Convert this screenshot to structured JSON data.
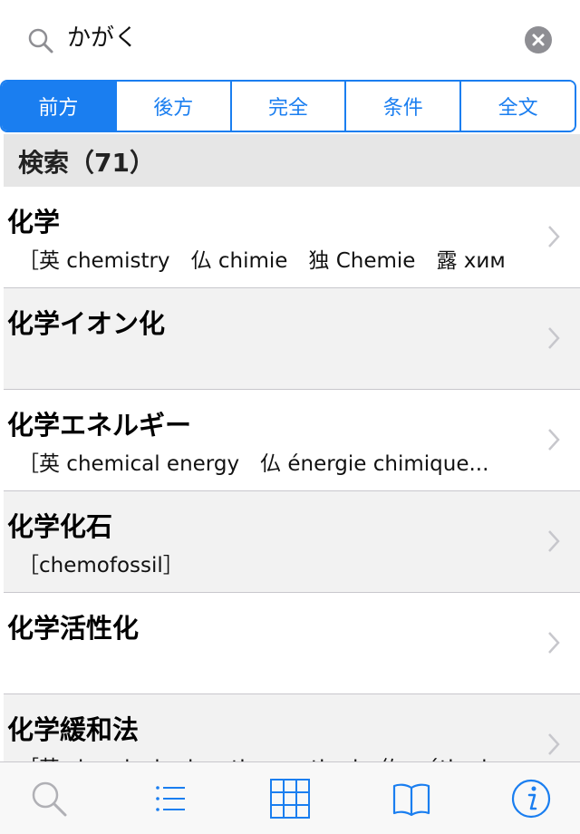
{
  "search": {
    "query": "かがく"
  },
  "segments": [
    "前方",
    "後方",
    "完全",
    "条件",
    "全文"
  ],
  "section": {
    "header": "検索（71）"
  },
  "results": [
    {
      "title": "化学",
      "subtitle": "［英 chemistry　仏 chimie　独 Chemie　露 хим"
    },
    {
      "title": "化学イオン化",
      "subtitle": ""
    },
    {
      "title": "化学エネルギー",
      "subtitle": "［英 chemical energy　仏 énergie chimique..."
    },
    {
      "title": "化学化石",
      "subtitle": "［chemofossil］"
    },
    {
      "title": "化学活性化",
      "subtitle": ""
    },
    {
      "title": "化学緩和法",
      "subtitle": "［英 chemical relaxation method　仏 méthod"
    }
  ],
  "tabbar": {
    "icons": [
      "search-icon",
      "list-icon",
      "grid-icon",
      "book-icon",
      "info-icon"
    ]
  },
  "colors": {
    "accent": "#1a7ef0",
    "clear": "#8e8e93",
    "header_bg": "#e6e6e6"
  }
}
